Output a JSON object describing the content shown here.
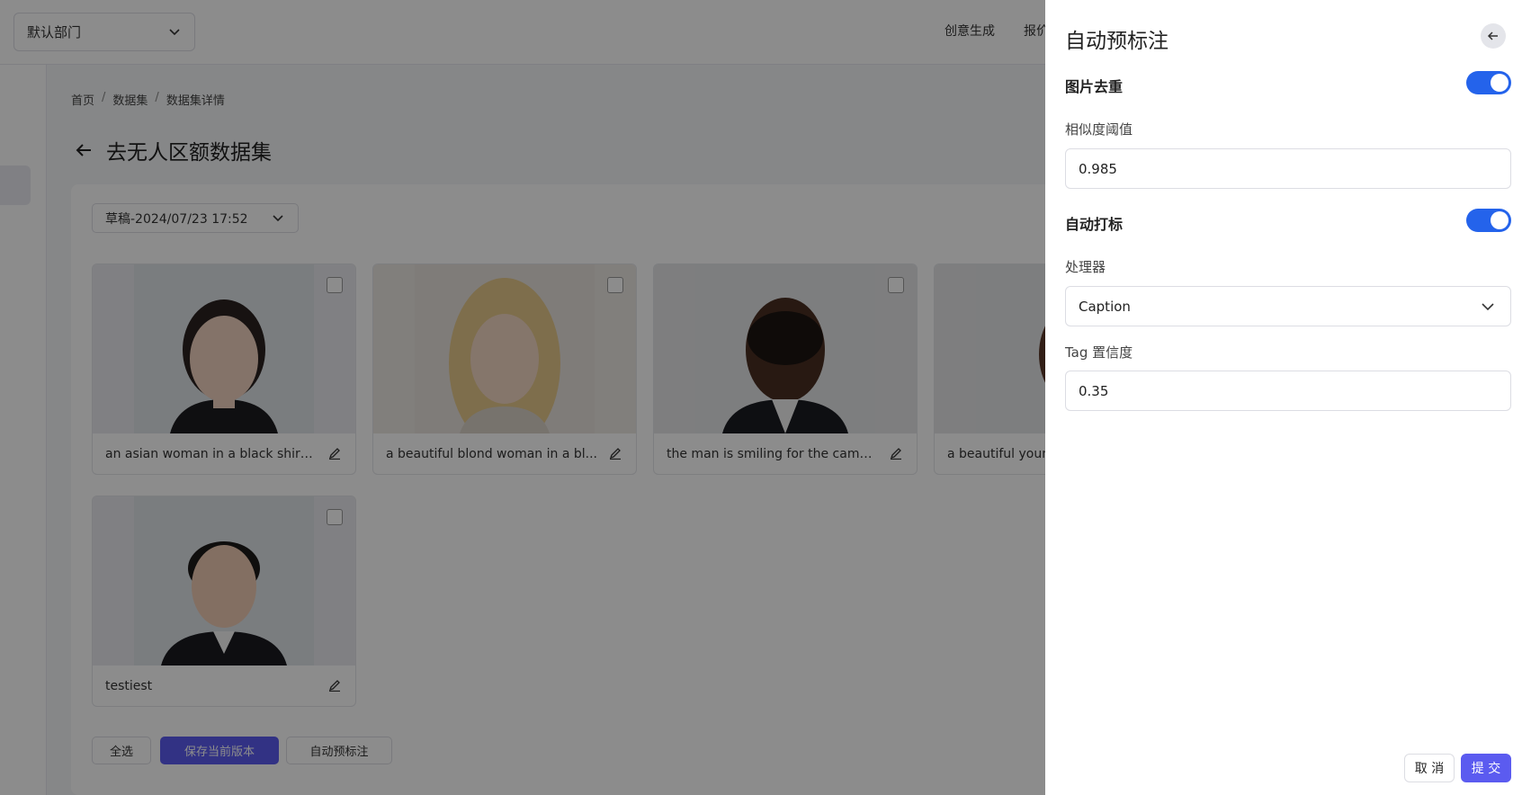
{
  "header": {
    "department_select": "默认部门",
    "nav_items": [
      "创意生成",
      "报价"
    ]
  },
  "breadcrumb": [
    "首页",
    "数据集",
    "数据集详情"
  ],
  "page_title": "去无人区额数据集",
  "version_select": "草稿-2024/07/23 17:52",
  "images": [
    {
      "caption": "an asian woman in a black shirt ..."
    },
    {
      "caption": "a beautiful blond woman in a bl..."
    },
    {
      "caption": "the man is smiling for the came..."
    },
    {
      "caption": "a beautiful youn"
    },
    {
      "caption": "testiest"
    }
  ],
  "actions": {
    "select_all": "全选",
    "save_version": "保存当前版本",
    "auto_prelabel": "自动预标注"
  },
  "drawer": {
    "title": "自动预标注",
    "dedup": {
      "title": "图片去重",
      "enabled": true,
      "threshold_label": "相似度阈值",
      "threshold_value": "0.985"
    },
    "auto_tag": {
      "title": "自动打标",
      "enabled": true,
      "processor_label": "处理器",
      "processor_value": "Caption",
      "confidence_label": "Tag 置信度",
      "confidence_value": "0.35"
    },
    "cancel_label": "取 消",
    "submit_label": "提 交"
  },
  "colors": {
    "toggle_on": "#2463eb",
    "primary_button": "#5b5bf0"
  }
}
